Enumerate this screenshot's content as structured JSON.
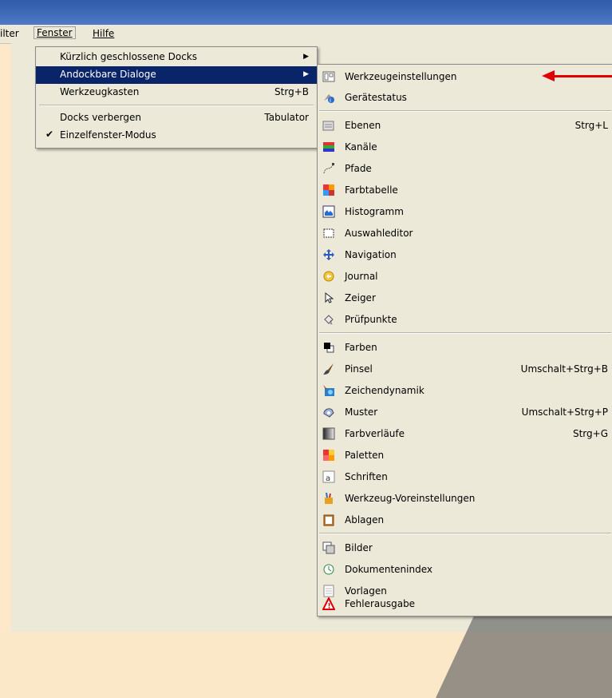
{
  "menubar": {
    "filter": "ilter",
    "fenster": "Fenster",
    "hilfe": "Hilfe"
  },
  "fenster_menu": {
    "recently_closed": "Kürzlich geschlossene Docks",
    "dockable": "Andockbare Dialoge",
    "toolbox": "Werkzeugkasten",
    "toolbox_acc": "Strg+B",
    "hide_docks": "Docks verbergen",
    "hide_docks_acc": "Tabulator",
    "single_window": "Einzelfenster-Modus"
  },
  "dialogs_menu": {
    "items": [
      {
        "label": "Werkzeugeinstellungen",
        "acc": "",
        "icon": "tool-options-icon"
      },
      {
        "label": "Gerätestatus",
        "acc": "",
        "icon": "device-status-icon"
      },
      {
        "label": "Ebenen",
        "acc": "Strg+L",
        "icon": "layers-icon"
      },
      {
        "label": "Kanäle",
        "acc": "",
        "icon": "channels-icon"
      },
      {
        "label": "Pfade",
        "acc": "",
        "icon": "paths-icon"
      },
      {
        "label": "Farbtabelle",
        "acc": "",
        "icon": "colormap-icon"
      },
      {
        "label": "Histogramm",
        "acc": "",
        "icon": "histogram-icon"
      },
      {
        "label": "Auswahleditor",
        "acc": "",
        "icon": "selection-editor-icon"
      },
      {
        "label": "Navigation",
        "acc": "",
        "icon": "navigation-icon"
      },
      {
        "label": "Journal",
        "acc": "",
        "icon": "journal-icon"
      },
      {
        "label": "Zeiger",
        "acc": "",
        "icon": "pointer-icon"
      },
      {
        "label": "Prüfpunkte",
        "acc": "",
        "icon": "sample-points-icon"
      },
      {
        "label": "Farben",
        "acc": "",
        "icon": "colors-icon"
      },
      {
        "label": "Pinsel",
        "acc": "Umschalt+Strg+B",
        "icon": "brushes-icon"
      },
      {
        "label": "Zeichendynamik",
        "acc": "",
        "icon": "paint-dynamics-icon"
      },
      {
        "label": "Muster",
        "acc": "Umschalt+Strg+P",
        "icon": "patterns-icon"
      },
      {
        "label": "Farbverläufe",
        "acc": "Strg+G",
        "icon": "gradients-icon"
      },
      {
        "label": "Paletten",
        "acc": "",
        "icon": "palettes-icon"
      },
      {
        "label": "Schriften",
        "acc": "",
        "icon": "fonts-icon"
      },
      {
        "label": "Werkzeug-Voreinstellungen",
        "acc": "",
        "icon": "tool-presets-icon"
      },
      {
        "label": "Ablagen",
        "acc": "",
        "icon": "buffers-icon"
      },
      {
        "label": "Bilder",
        "acc": "",
        "icon": "images-icon"
      },
      {
        "label": "Dokumentenindex",
        "acc": "",
        "icon": "document-history-icon"
      },
      {
        "label": "Vorlagen",
        "acc": "",
        "icon": "templates-icon"
      },
      {
        "label": "Fehlerausgabe",
        "acc": "",
        "icon": "error-console-icon"
      }
    ]
  },
  "colors": {
    "highlight": "#0a246a",
    "arrow": "#e00000",
    "menu_bg": "#ece9d8"
  }
}
